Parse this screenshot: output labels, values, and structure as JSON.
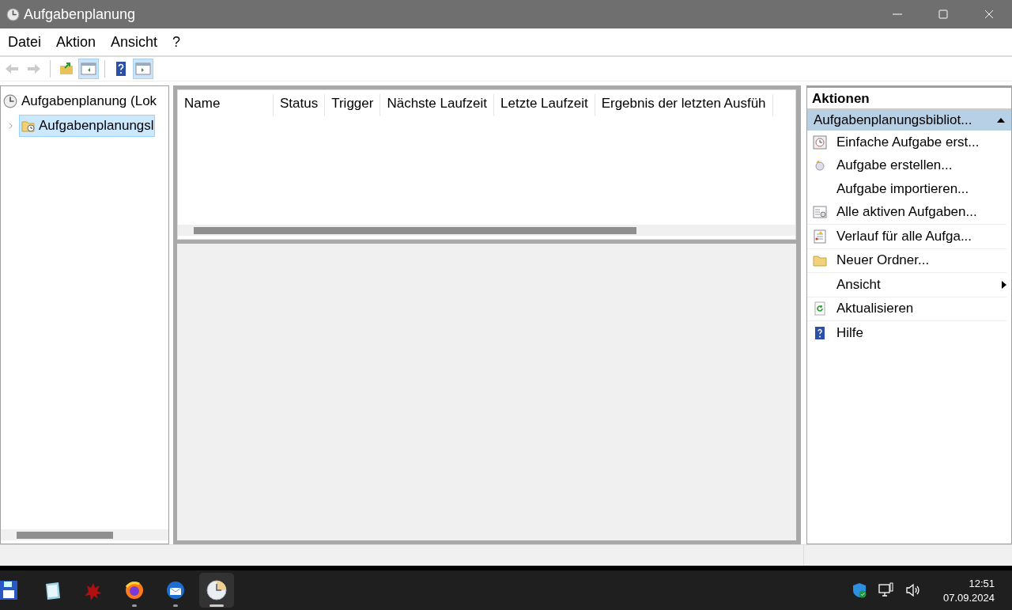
{
  "window": {
    "title": "Aufgabenplanung"
  },
  "menu": [
    "Datei",
    "Aktion",
    "Ansicht",
    "?"
  ],
  "toolbar": [
    {
      "kind": "back",
      "disabled": true,
      "pressed": false
    },
    {
      "kind": "forward",
      "disabled": true,
      "pressed": false
    },
    {
      "kind": "up-folder",
      "disabled": false,
      "pressed": false
    },
    {
      "kind": "console-tree",
      "disabled": false,
      "pressed": true
    },
    {
      "kind": "help",
      "disabled": false,
      "pressed": false
    },
    {
      "kind": "action-pane",
      "disabled": false,
      "pressed": true
    }
  ],
  "tree": [
    {
      "label": "Aufgabenplanung (Lok",
      "selected": false,
      "children": [
        {
          "label": "Aufgabenplanungsl",
          "selected": true,
          "expanded": false
        }
      ]
    }
  ],
  "table": {
    "columns": [
      "Name",
      "Status",
      "Trigger",
      "Nächste Laufzeit",
      "Letzte Laufzeit",
      "Ergebnis der letzten Ausfüh"
    ]
  },
  "actions": {
    "title": "Aktionen",
    "section": "Aufgabenplanungsbibliot...",
    "items": [
      {
        "label": "Einfache Aufgabe erst...",
        "kind": "wizard",
        "submenu": false
      },
      {
        "label": "Aufgabe erstellen...",
        "kind": "task",
        "submenu": false
      },
      {
        "label": "Aufgabe importieren...",
        "kind": "plain",
        "submenu": false
      },
      {
        "label": "Alle aktiven Aufgaben...",
        "kind": "list",
        "submenu": false
      },
      {
        "label": "Verlauf für alle Aufga...",
        "kind": "history",
        "submenu": false
      },
      {
        "label": "Neuer Ordner...",
        "kind": "folder",
        "submenu": false
      },
      {
        "label": "Ansicht",
        "kind": "plain",
        "submenu": true
      },
      {
        "label": "Aktualisieren",
        "kind": "refresh",
        "submenu": false
      },
      {
        "label": "Hilfe",
        "kind": "help",
        "submenu": false
      }
    ]
  },
  "taskbar": {
    "apps": [
      {
        "kind": "floppy",
        "running": false,
        "selected": false
      },
      {
        "kind": "notepad",
        "running": false,
        "selected": false
      },
      {
        "kind": "splat",
        "running": false,
        "selected": false
      },
      {
        "kind": "firefox",
        "running": true,
        "selected": false
      },
      {
        "kind": "mail",
        "running": true,
        "selected": false
      },
      {
        "kind": "clock",
        "running": true,
        "selected": true
      }
    ],
    "time": "12:51",
    "date": "07.09.2024"
  }
}
